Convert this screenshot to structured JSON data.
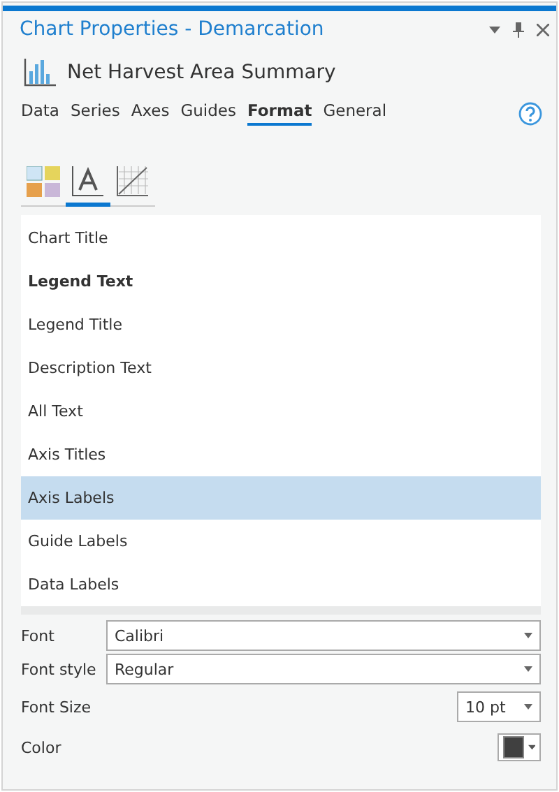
{
  "window": {
    "title": "Chart Properties - Demarcation"
  },
  "chart": {
    "name": "Net Harvest Area Summary"
  },
  "tabs": [
    {
      "label": "Data",
      "selected": false
    },
    {
      "label": "Series",
      "selected": false
    },
    {
      "label": "Axes",
      "selected": false
    },
    {
      "label": "Guides",
      "selected": false
    },
    {
      "label": "Format",
      "selected": true
    },
    {
      "label": "General",
      "selected": false
    }
  ],
  "format_tabs": [
    {
      "kind": "symbols",
      "selected": false
    },
    {
      "kind": "text",
      "selected": true
    },
    {
      "kind": "grid",
      "selected": false
    }
  ],
  "elements": [
    {
      "label": "Chart Title",
      "bold": false,
      "selected": false
    },
    {
      "label": "Legend Text",
      "bold": true,
      "selected": false
    },
    {
      "label": "Legend Title",
      "bold": false,
      "selected": false
    },
    {
      "label": "Description Text",
      "bold": false,
      "selected": false
    },
    {
      "label": "All Text",
      "bold": false,
      "selected": false
    },
    {
      "label": "Axis Titles",
      "bold": false,
      "selected": false
    },
    {
      "label": "Axis Labels",
      "bold": false,
      "selected": true
    },
    {
      "label": "Guide Labels",
      "bold": false,
      "selected": false
    },
    {
      "label": "Data Labels",
      "bold": false,
      "selected": false
    }
  ],
  "font": {
    "label": "Font",
    "value": "Calibri"
  },
  "font_style": {
    "label": "Font style",
    "value": "Regular"
  },
  "font_size": {
    "label": "Font Size",
    "value": "10 pt"
  },
  "color": {
    "label": "Color",
    "color": "#404040"
  }
}
